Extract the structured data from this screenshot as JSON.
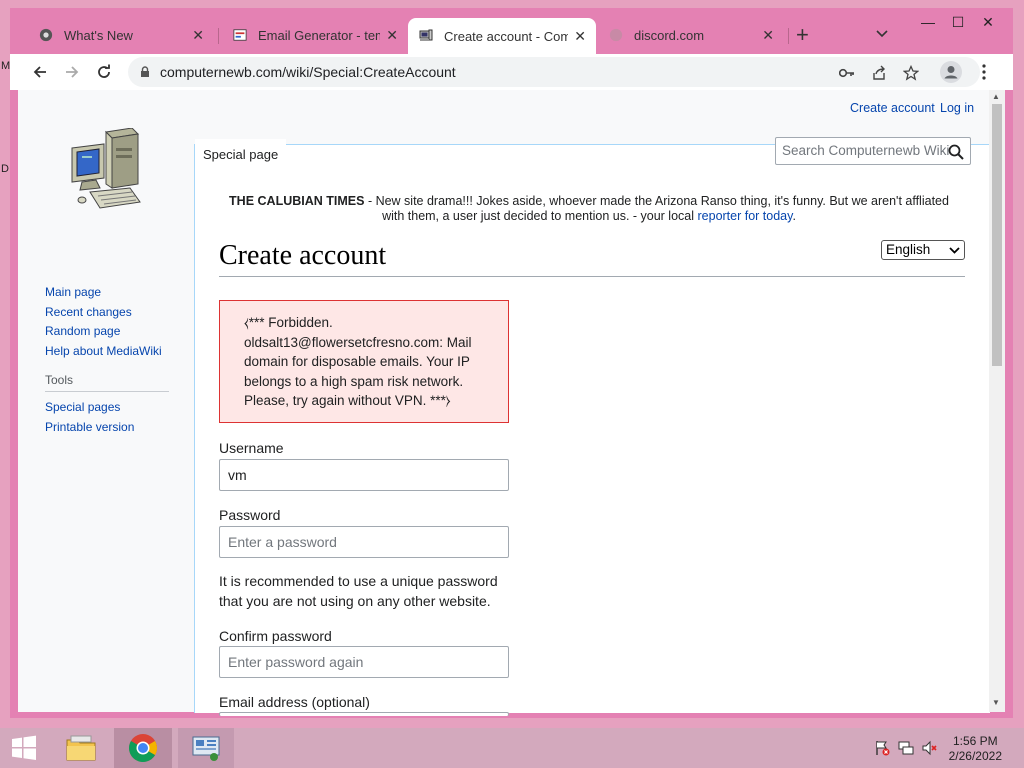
{
  "browser": {
    "tabs": [
      {
        "title": "What's New",
        "favicon": "chrome-icon"
      },
      {
        "title": "Email Generator - temp",
        "favicon": "email-generator-icon"
      },
      {
        "title": "Create account - Comp",
        "favicon": "computer-icon",
        "active": true
      },
      {
        "title": "discord.com",
        "favicon": "globe-icon"
      }
    ],
    "url": "computernewb.com/wiki/Special:CreateAccount"
  },
  "wiki": {
    "personal": {
      "create_account": "Create account",
      "log_in": "Log in"
    },
    "special_tab": "Special page",
    "search_placeholder": "Search Computernewb Wiki",
    "nav": [
      {
        "label": "Main page"
      },
      {
        "label": "Recent changes"
      },
      {
        "label": "Random page"
      },
      {
        "label": "Help about MediaWiki"
      }
    ],
    "tools_heading": "Tools",
    "tools": [
      {
        "label": "Special pages"
      },
      {
        "label": "Printable version"
      }
    ],
    "sitenotice": {
      "bold": "THE CALUBIAN TIMES",
      "line1_rest": " - New site drama!!! Jokes aside, whoever made the Arizona Ranso thing, it's funny. But we aren't affliated",
      "line2": "with them, a user just decided to mention us. - your local ",
      "link": "reporter for today",
      "end": "."
    },
    "page_title": "Create account",
    "language": "English",
    "error_message": "⧼*** Forbidden. oldsalt13@flowersetcfresno.com: Mail domain for disposable emails. Your IP belongs to a high spam risk network. Please, try again without VPN. ***⧽",
    "form": {
      "username_label": "Username",
      "username_value": "vm",
      "password_label": "Password",
      "password_placeholder": "Enter a password",
      "password_help": "It is recommended to use a unique password that you are not using on any other website.",
      "confirm_label": "Confirm password",
      "confirm_placeholder": "Enter password again",
      "email_label": "Email address (optional)"
    }
  },
  "taskbar": {
    "time": "1:56 PM",
    "date": "2/26/2022"
  },
  "colors": {
    "window_frame": "#e481b3",
    "desktop": "#e6a1bf",
    "taskbar": "#d3a9bd",
    "link": "#0645ad",
    "error_bg": "#fee7e6",
    "error_border": "#dd3333"
  }
}
